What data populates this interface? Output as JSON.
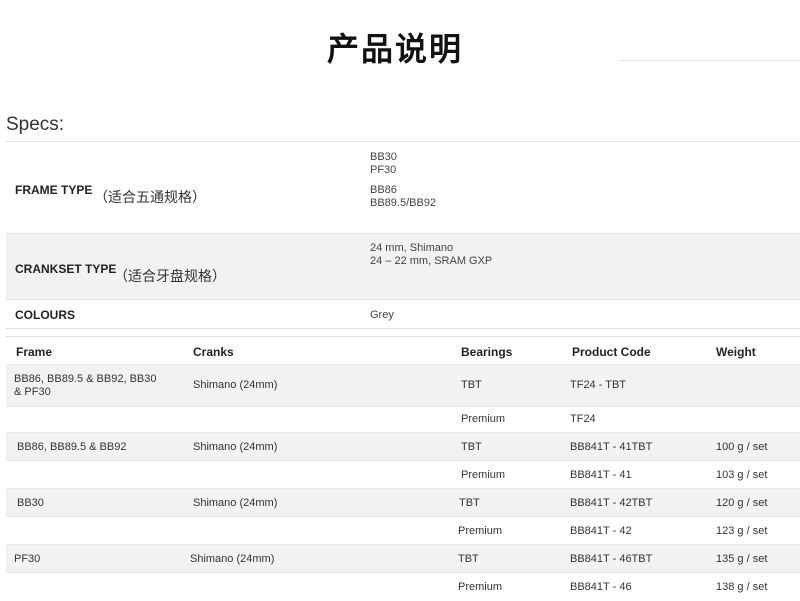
{
  "title": "产品说明",
  "specs_label": "Specs:",
  "specs": {
    "frame_type": {
      "label": "FRAME TYPE",
      "note_cn": "（适合五通规格）",
      "values": [
        "BB30",
        "PF30",
        "BB86",
        "BB89.5/BB92"
      ]
    },
    "crankset_type": {
      "label": "CRANKSET TYPE",
      "note_cn": "（适合牙盘规格）",
      "values": [
        "24 mm, Shimano",
        "24 – 22 mm, SRAM GXP"
      ]
    },
    "colours": {
      "label": "COLOURS",
      "value": "Grey"
    }
  },
  "table": {
    "headers": [
      "Frame",
      "Cranks",
      "Bearings",
      "Product Code",
      "Weight"
    ],
    "rows": [
      {
        "frame": "BB86, BB89.5 & BB92, BB30 & PF30",
        "cranks": "Shimano (24mm)",
        "bearings": "TBT",
        "code": "TF24 - TBT",
        "weight": ""
      },
      {
        "frame": "",
        "cranks": "",
        "bearings": "Premium",
        "code": "TF24",
        "weight": ""
      },
      {
        "frame": "BB86, BB89.5 & BB92",
        "cranks": "Shimano (24mm)",
        "bearings": "TBT",
        "code": "BB841T - 41TBT",
        "weight": "100 g / set"
      },
      {
        "frame": "",
        "cranks": "",
        "bearings": "Premium",
        "code": "BB841T - 41",
        "weight": "103 g / set"
      },
      {
        "frame": "BB30",
        "cranks": "Shimano (24mm)",
        "bearings": "TBT",
        "code": "BB841T - 42TBT",
        "weight": "120 g / set"
      },
      {
        "frame": "",
        "cranks": "",
        "bearings": "Premium",
        "code": "BB841T - 42",
        "weight": "123 g / set"
      },
      {
        "frame": "PF30",
        "cranks": "Shimano (24mm)",
        "bearings": "TBT",
        "code": "BB841T - 46TBT",
        "weight": "135 g / set"
      },
      {
        "frame": "",
        "cranks": "",
        "bearings": "Premium",
        "code": "BB841T - 46",
        "weight": "138 g / set"
      }
    ]
  }
}
